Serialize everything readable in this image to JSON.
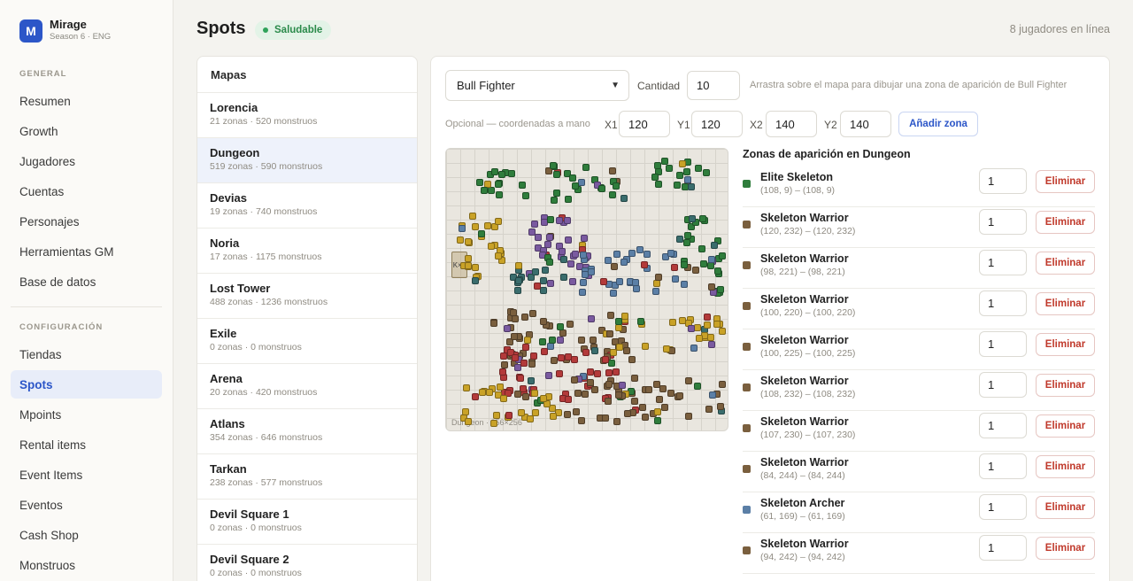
{
  "brand": {
    "logo_letter": "M",
    "name": "Mirage",
    "subtitle": "Season 6 · ENG"
  },
  "sidebar": {
    "sections": [
      {
        "label": "GENERAL",
        "items": [
          "Resumen",
          "Growth",
          "Jugadores",
          "Cuentas",
          "Personajes",
          "Herramientas GM",
          "Base de datos"
        ]
      },
      {
        "label": "CONFIGURACIÓN",
        "items": [
          "Tiendas",
          "Spots",
          "Mpoints",
          "Rental items",
          "Event Items",
          "Eventos",
          "Cash Shop",
          "Monstruos"
        ]
      }
    ],
    "active_item": "Spots"
  },
  "header": {
    "title": "Spots",
    "status_badge": "Saludable",
    "online": "8 jugadores en línea"
  },
  "maps_panel": {
    "title": "Mapas",
    "selected": "Dungeon",
    "maps": [
      {
        "name": "Lorencia",
        "meta": "21 zonas · 520 monstruos"
      },
      {
        "name": "Dungeon",
        "meta": "519 zonas · 590 monstruos"
      },
      {
        "name": "Devias",
        "meta": "19 zonas · 740 monstruos"
      },
      {
        "name": "Noria",
        "meta": "17 zonas · 1175 monstruos"
      },
      {
        "name": "Lost Tower",
        "meta": "488 zonas · 1236 monstruos"
      },
      {
        "name": "Exile",
        "meta": "0 zonas · 0 monstruos"
      },
      {
        "name": "Arena",
        "meta": "20 zonas · 420 monstruos"
      },
      {
        "name": "Atlans",
        "meta": "354 zonas · 646 monstruos"
      },
      {
        "name": "Tarkan",
        "meta": "238 zonas · 577 monstruos"
      },
      {
        "name": "Devil Square 1",
        "meta": "0 zonas · 0 monstruos"
      },
      {
        "name": "Devil Square 2",
        "meta": "0 zonas · 0 monstruos"
      }
    ]
  },
  "controls": {
    "monster_select": "Bull Fighter",
    "quantity_label": "Cantidad",
    "quantity_value": "10",
    "drag_hint": "Arrastra sobre el mapa para dibujar una zona de aparición de Bull Fighter",
    "manual_hint": "Opcional — coordenadas a mano",
    "x1_label": "X1",
    "x1_value": "120",
    "y1_label": "Y1",
    "y1_value": "120",
    "x2_label": "X2",
    "x2_value": "140",
    "y2_label": "Y2",
    "y2_value": "140",
    "add_button": "Añadir zona"
  },
  "map_view": {
    "caption": "Dungeon · 256×256",
    "box_label": "K×3"
  },
  "zones": {
    "title": "Zonas de aparición en Dungeon",
    "delete_label": "Eliminar",
    "items": [
      {
        "name": "Elite Skeleton",
        "range": "(108, 9) – (108, 9)",
        "qty": "1",
        "color": "#2f7d3c"
      },
      {
        "name": "Skeleton Warrior",
        "range": "(120, 232) – (120, 232)",
        "qty": "1",
        "color": "#7a5f3e"
      },
      {
        "name": "Skeleton Warrior",
        "range": "(98, 221) – (98, 221)",
        "qty": "1",
        "color": "#7a5f3e"
      },
      {
        "name": "Skeleton Warrior",
        "range": "(100, 220) – (100, 220)",
        "qty": "1",
        "color": "#7a5f3e"
      },
      {
        "name": "Skeleton Warrior",
        "range": "(100, 225) – (100, 225)",
        "qty": "1",
        "color": "#7a5f3e"
      },
      {
        "name": "Skeleton Warrior",
        "range": "(108, 232) – (108, 232)",
        "qty": "1",
        "color": "#7a5f3e"
      },
      {
        "name": "Skeleton Warrior",
        "range": "(107, 230) – (107, 230)",
        "qty": "1",
        "color": "#7a5f3e"
      },
      {
        "name": "Skeleton Warrior",
        "range": "(84, 244) – (84, 244)",
        "qty": "1",
        "color": "#7a5f3e"
      },
      {
        "name": "Skeleton Archer",
        "range": "(61, 169) – (61, 169)",
        "qty": "1",
        "color": "#5b7fa6"
      },
      {
        "name": "Skeleton Warrior",
        "range": "(94, 242) – (94, 242)",
        "qty": "1",
        "color": "#7a5f3e"
      }
    ]
  },
  "colors": {
    "accent": "#2c56c8",
    "success": "#2fa35a",
    "danger": "#c0392b"
  }
}
